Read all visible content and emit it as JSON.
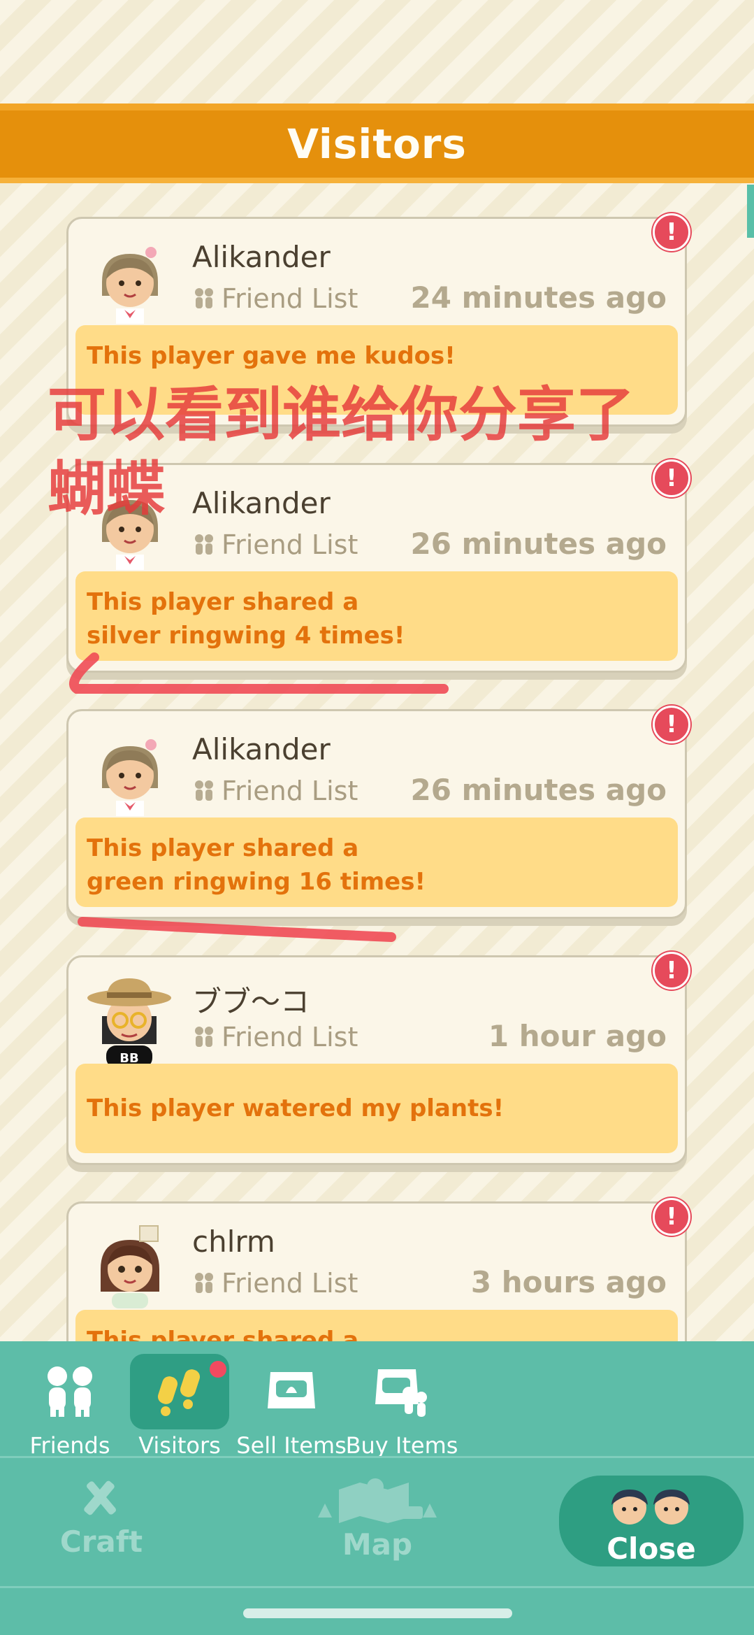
{
  "header": {
    "title": "Visitors"
  },
  "annotation": {
    "line1": "可以看到谁给你分享了",
    "line2": "蝴蝶"
  },
  "entries": [
    {
      "name": "Alikander",
      "list": "Friend List",
      "time": "24 minutes ago",
      "message": "This player gave me kudos!",
      "alert": "!"
    },
    {
      "name": "Alikander",
      "list": "Friend List",
      "time": "26 minutes ago",
      "message_line1": "This player shared a",
      "message_line2": "silver ringwing 4 times!",
      "alert": "!"
    },
    {
      "name": "Alikander",
      "list": "Friend List",
      "time": "26 minutes ago",
      "message_line1": "This player shared a",
      "message_line2": "green ringwing 16 times!",
      "alert": "!"
    },
    {
      "name": "ブブ〜コ",
      "list": "Friend List",
      "time": "1 hour ago",
      "message": "This player watered my plants!",
      "alert": "!"
    },
    {
      "name": "chlrm",
      "list": "Friend List",
      "time": "3 hours ago",
      "message": "This player shared a",
      "alert": "!"
    }
  ],
  "avatar_badge": "BB",
  "tabs": [
    {
      "label": "Friends"
    },
    {
      "label": "Visitors"
    },
    {
      "label": "Sell Items"
    },
    {
      "label": "Buy Items"
    }
  ],
  "nav": {
    "craft": "Craft",
    "map": "Map",
    "close": "Close"
  },
  "colors": {
    "header": "#e5900c",
    "panel": "#5dbda8",
    "active_tab": "#2f9e84",
    "alert": "#e64a5b",
    "message_bg": "#ffdc88",
    "message_text": "#e3720c",
    "annotation": "#e63a3a"
  }
}
